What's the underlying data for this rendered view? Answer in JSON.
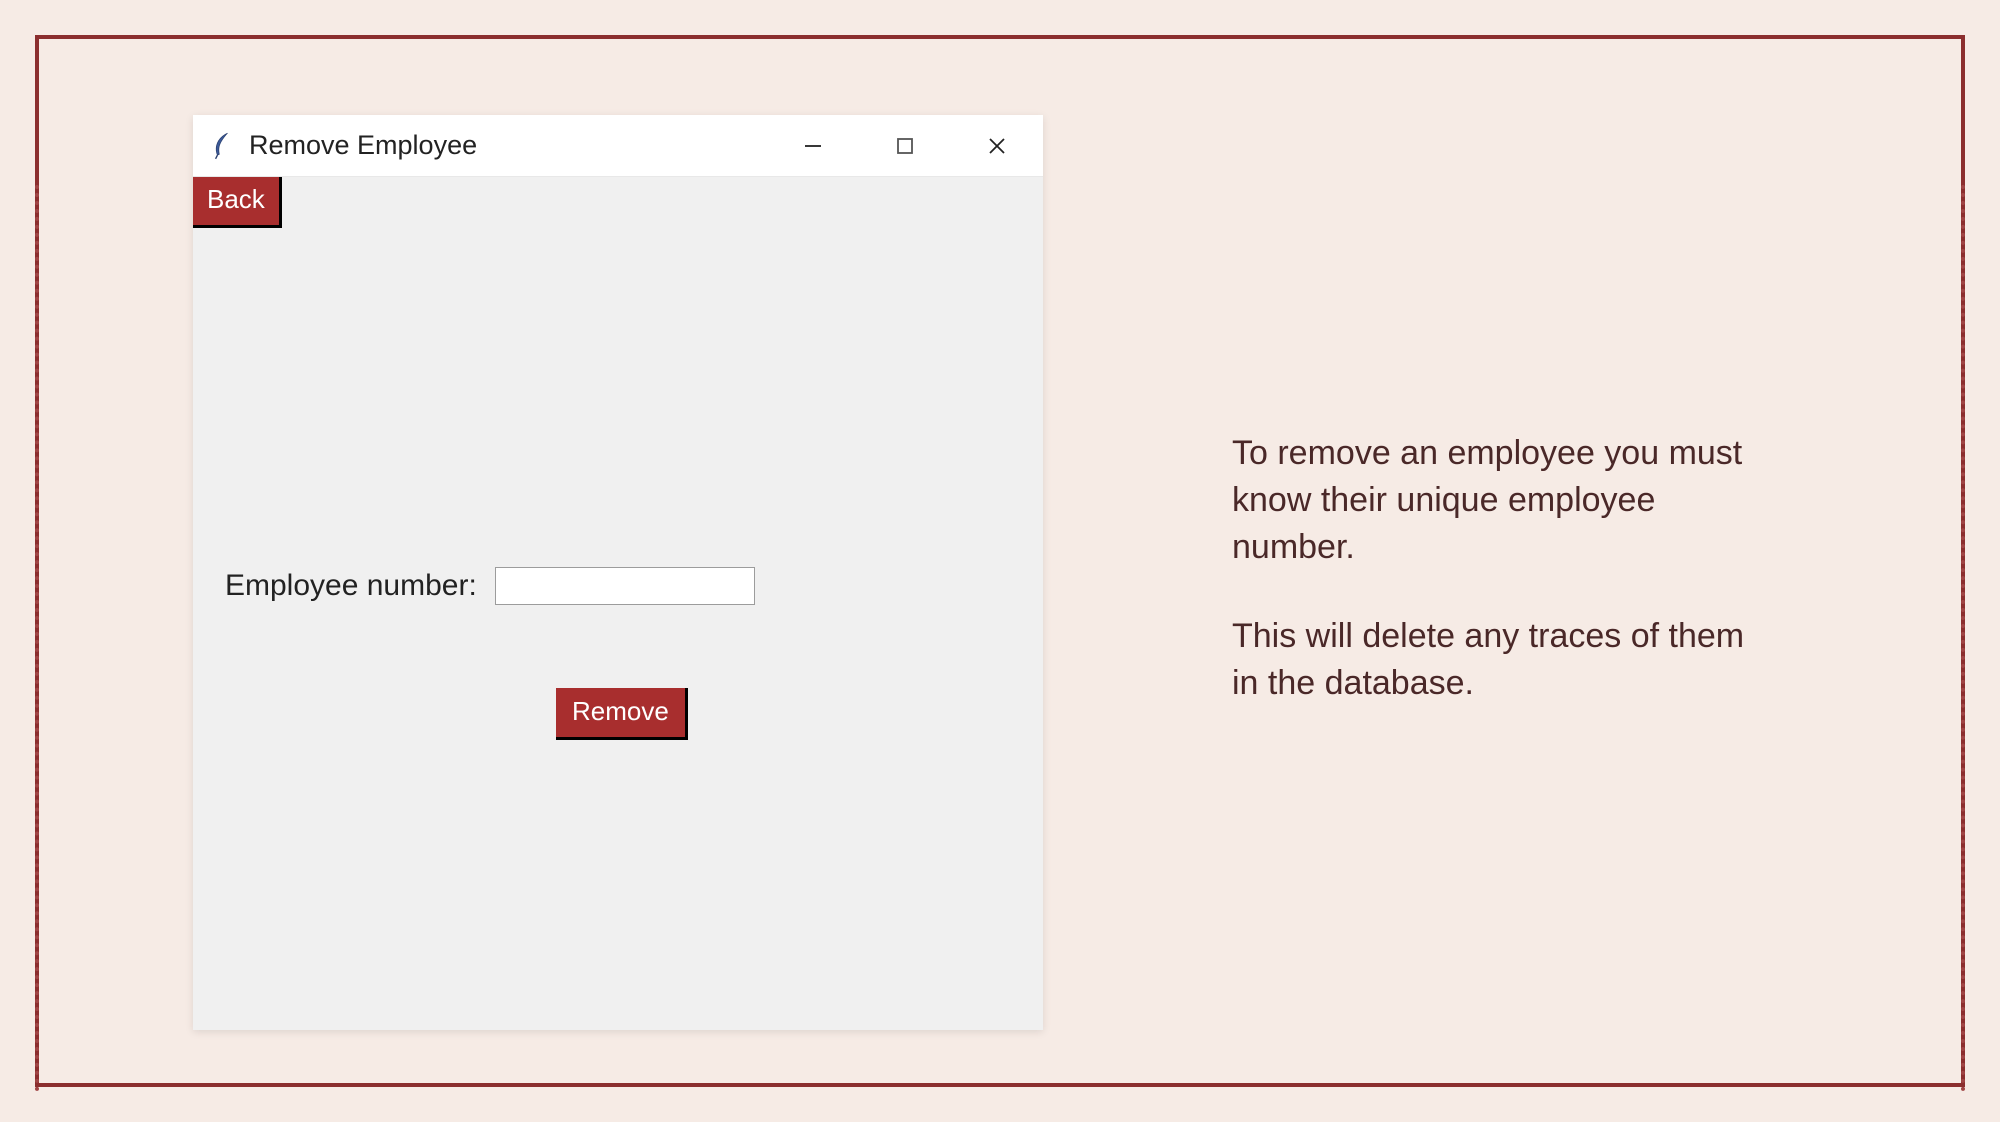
{
  "window": {
    "title": "Remove Employee"
  },
  "buttons": {
    "back": "Back",
    "remove": "Remove"
  },
  "form": {
    "employee_number_label": "Employee number:",
    "employee_number_value": ""
  },
  "description": {
    "para1": "To remove an employee you must know their unique employee number.",
    "para2": "This will delete any traces of them in the database."
  }
}
